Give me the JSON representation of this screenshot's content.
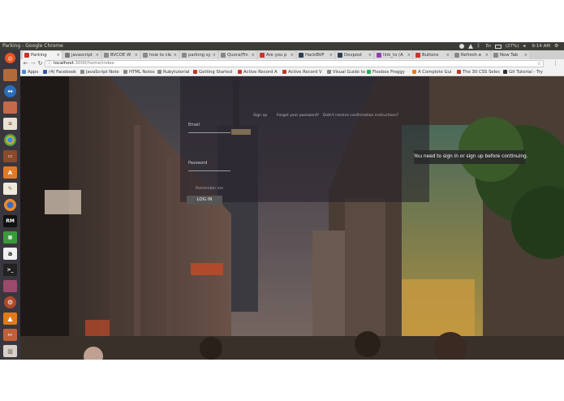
{
  "topbar": {
    "window_title": "Parking - Google Chrome",
    "battery": "(27%)",
    "clock": "9:14 AM"
  },
  "launcher": {
    "items": [
      "dash-icon",
      "files-icon",
      "remote-desktop-icon",
      "folder-icon",
      "document-icon",
      "chrome-icon",
      "terminal-icon",
      "software-center-icon",
      "text-editor-icon",
      "firefox-icon",
      "rubymine-icon",
      "spreadsheet-icon",
      "amazon-icon",
      "console-icon",
      "files-icon",
      "system-settings-icon",
      "vlc-icon",
      "tools-icon",
      "trash-icon"
    ]
  },
  "tabs": [
    {
      "label": "Parking",
      "color": "#c0392b"
    },
    {
      "label": "javascript",
      "color": "#777"
    },
    {
      "label": "BVCOE W",
      "color": "#888"
    },
    {
      "label": "how to cle",
      "color": "#888"
    },
    {
      "label": "parking sy",
      "color": "#888"
    },
    {
      "label": "Quora(Fin",
      "color": "#888"
    },
    {
      "label": "Are you p",
      "color": "#c0392b"
    },
    {
      "label": "HackBVP",
      "color": "#2c3e50"
    },
    {
      "label": "Devpost",
      "color": "#2c3e50"
    },
    {
      "label": "link_to (A",
      "color": "#8e44ad"
    },
    {
      "label": "Buttons",
      "color": "#c0392b"
    },
    {
      "label": "Refresh a",
      "color": "#888"
    },
    {
      "label": "New Tab",
      "color": "#888"
    }
  ],
  "omnibar": {
    "url_host": "localhost",
    "url_path": ":3000/home/index"
  },
  "bookmarks": [
    {
      "label": "Apps",
      "color": "#4a89dc"
    },
    {
      "label": "(4) Facebook",
      "color": "#3b5998"
    },
    {
      "label": "JavaScript Note",
      "color": "#888"
    },
    {
      "label": "HTML Notes",
      "color": "#888"
    },
    {
      "label": "Rubytutorial",
      "color": "#888"
    },
    {
      "label": "Getting Started",
      "color": "#c0392b"
    },
    {
      "label": "Active Record A",
      "color": "#c0392b"
    },
    {
      "label": "Active Record V",
      "color": "#c0392b"
    },
    {
      "label": "Visual Guide to",
      "color": "#888"
    },
    {
      "label": "Flexbox Froggy",
      "color": "#27ae60"
    },
    {
      "label": "A Complete Gui",
      "color": "#e67e22"
    },
    {
      "label": "The 30 CSS Selec",
      "color": "#c0392b"
    },
    {
      "label": "Git Tutorial - Try",
      "color": "#333"
    }
  ],
  "page": {
    "nav_links": [
      "Sign up",
      "Forgot your password?",
      "Didn't receive confirmation instructions?"
    ],
    "email_label": "Email",
    "password_label": "Password",
    "remember_label": "Remember me",
    "login_button": "LOG IN",
    "alert": "You need to sign in or sign up before continuing."
  },
  "colors": {
    "panel": "#3c3b37",
    "launcher": "#3a3640",
    "chrome_bg": "#f2f2f2",
    "alert_bg": "#282828"
  }
}
